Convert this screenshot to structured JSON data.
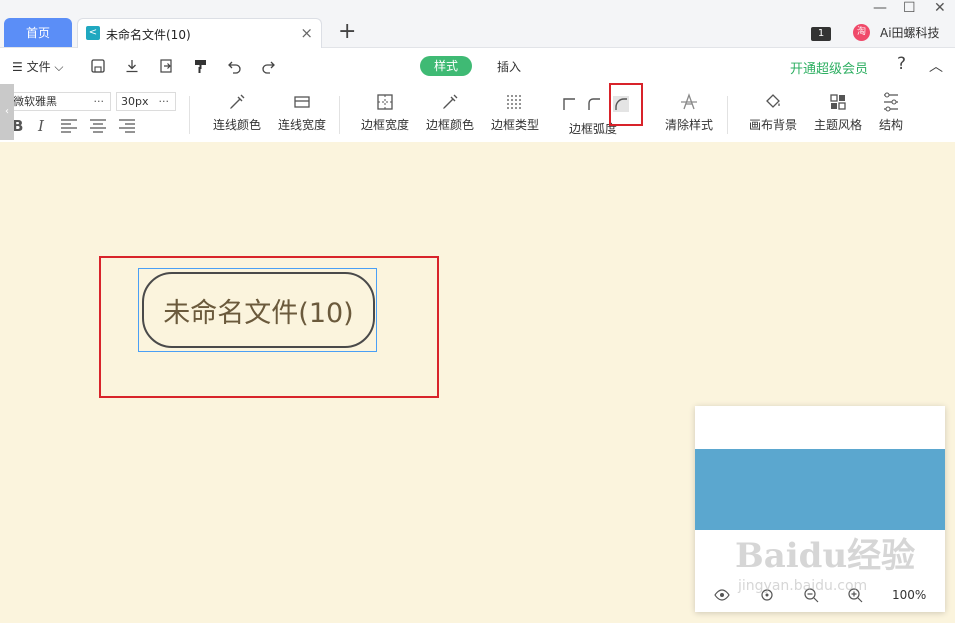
{
  "tabs": {
    "home": "首页",
    "file": "未命名文件(10)",
    "add": "+",
    "close": "×"
  },
  "window": {
    "minimize": "—",
    "maximize": "☐",
    "close": "✕"
  },
  "user": {
    "badge": "1",
    "avatar": "淘",
    "name": "Ai田螺科技"
  },
  "menubar": {
    "file": "☰ 文件 ⌵",
    "mode_style": "样式",
    "mode_insert": "插入",
    "vip": "开通超级会员",
    "help": "?",
    "collapse": "︿"
  },
  "toolbar": {
    "font_name": "微软雅黑",
    "font_size": "30px",
    "dots": "···",
    "tools": {
      "line_color": "连线颜色",
      "line_width": "连线宽度",
      "border_width": "边框宽度",
      "border_color": "边框颜色",
      "border_type": "边框类型",
      "border_radius": "边框弧度",
      "clear_style": "清除样式",
      "canvas_bg": "画布背景",
      "theme_style": "主题风格",
      "structure": "结构"
    }
  },
  "canvas": {
    "topic_text": "未命名文件(10)"
  },
  "minimap": {
    "zoom": "100%"
  },
  "watermark": {
    "brand": "Baidu经验",
    "url": "jingyan.baidu.com"
  },
  "colors": {
    "accent_green": "#3fba74",
    "home_tab_blue": "#5b8ef7",
    "canvas_bg": "#fbf4dd",
    "selection_blue": "#4a9ff5",
    "highlight_red": "#d8232a",
    "minimap_blue": "#5ba7cf"
  }
}
